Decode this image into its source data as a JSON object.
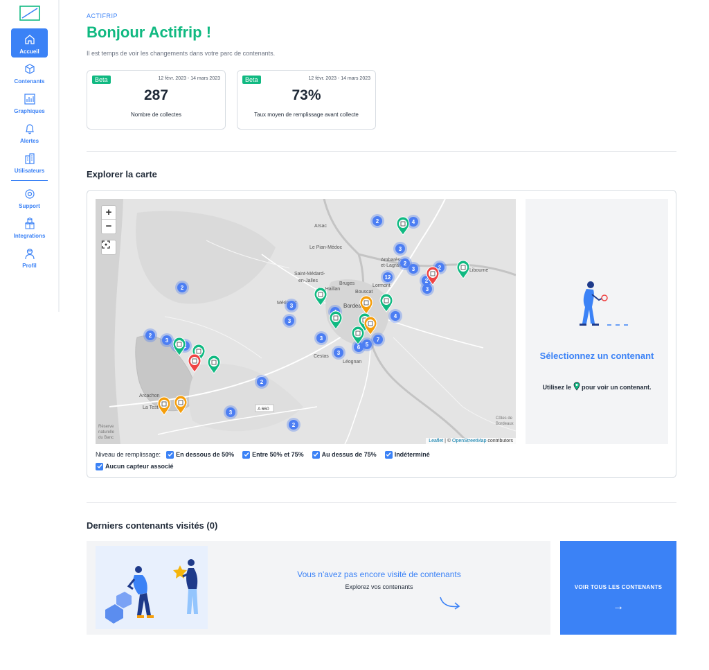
{
  "sidebar": {
    "items": [
      {
        "label": "Accueil",
        "icon": "home-icon",
        "active": true
      },
      {
        "label": "Contenants",
        "icon": "cube-icon"
      },
      {
        "label": "Graphiques",
        "icon": "chart-icon"
      },
      {
        "label": "Alertes",
        "icon": "bell-icon"
      },
      {
        "label": "Utilisateurs",
        "icon": "users-icon"
      },
      {
        "label": "Support",
        "icon": "lifebuoy-icon"
      },
      {
        "label": "Integrations",
        "icon": "cubes-icon"
      },
      {
        "label": "Profil",
        "icon": "profile-icon"
      }
    ]
  },
  "header": {
    "account": "ACTIFRIP",
    "greeting": "Bonjour Actifrip !",
    "subtitle": "Il est temps de voir les changements dans votre parc de contenants."
  },
  "stats": [
    {
      "badge": "Beta",
      "date": "12 févr. 2023 - 14 mars 2023",
      "value": "287",
      "label": "Nombre de collectes"
    },
    {
      "badge": "Beta",
      "date": "12 févr. 2023 - 14 mars 2023",
      "value": "73%",
      "label": "Taux moyen de remplissage avant collecte"
    }
  ],
  "map_section": {
    "title": "Explorer la carte",
    "zoom_in": "+",
    "zoom_out": "−",
    "attribution_leaflet": "Leaflet",
    "attribution_sep": " | © ",
    "attribution_osm": "OpenStreetMap",
    "attribution_tail": " contributors",
    "places": [
      "Arsac",
      "Le Pian-Médoc",
      "Saint-Médard-en-Jalles",
      "Le Haillan",
      "Bruges",
      "Bordeaux",
      "Mérignac",
      "Cestas",
      "Léognan",
      "Ambarès-et-Lagrave",
      "Libourne",
      "Arcachon",
      "La Teste",
      "A 660",
      "Côtes de Bordeaux",
      "Réserve naturelle du Banc",
      "Lormont",
      "Bouscat"
    ],
    "filters": {
      "label": "Niveau de remplissage:",
      "options": [
        "En dessous de 50%",
        "Entre 50% et 75%",
        "Au dessus de 75%",
        "Indéterminé",
        "Aucun capteur associé"
      ]
    },
    "panel": {
      "title": "Sélectionnez un contenant",
      "text_before": "Utilisez le",
      "text_after": "pour voir un contenant."
    },
    "colors": {
      "cluster": "#4c7ef3",
      "green": "#10b981",
      "orange": "#f59e0b",
      "red": "#ef4444"
    },
    "clusters": [
      "2",
      "4",
      "3",
      "2",
      "3",
      "12",
      "3",
      "2",
      "2",
      "3",
      "3",
      "4",
      "4",
      "2",
      "3",
      "2",
      "2",
      "3",
      "7",
      "5",
      "6",
      "3",
      "2",
      "3",
      "2",
      "2"
    ]
  },
  "visited": {
    "title": "Derniers contenants visités (0)",
    "empty_title": "Vous n'avez pas encore visité de contenants",
    "empty_sub": "Explorez vos contenants",
    "cta_label": "VOIR TOUS LES CONTENANTS",
    "cta_arrow": "→"
  }
}
